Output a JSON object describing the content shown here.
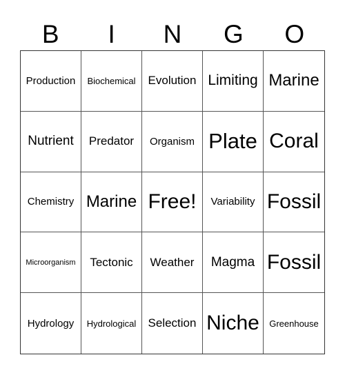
{
  "header": [
    "B",
    "I",
    "N",
    "G",
    "O"
  ],
  "rows": [
    [
      "Production",
      "Biochemical",
      "Evolution",
      "Limiting",
      "Marine"
    ],
    [
      "Nutrient",
      "Predator",
      "Organism",
      "Plate",
      "Coral"
    ],
    [
      "Chemistry",
      "Marine",
      "Free!",
      "Variability",
      "Fossil"
    ],
    [
      "Microorganism",
      "Tectonic",
      "Weather",
      "Magma",
      "Fossil"
    ],
    [
      "Hydrology",
      "Hydrological",
      "Selection",
      "Niche",
      "Greenhouse"
    ]
  ]
}
